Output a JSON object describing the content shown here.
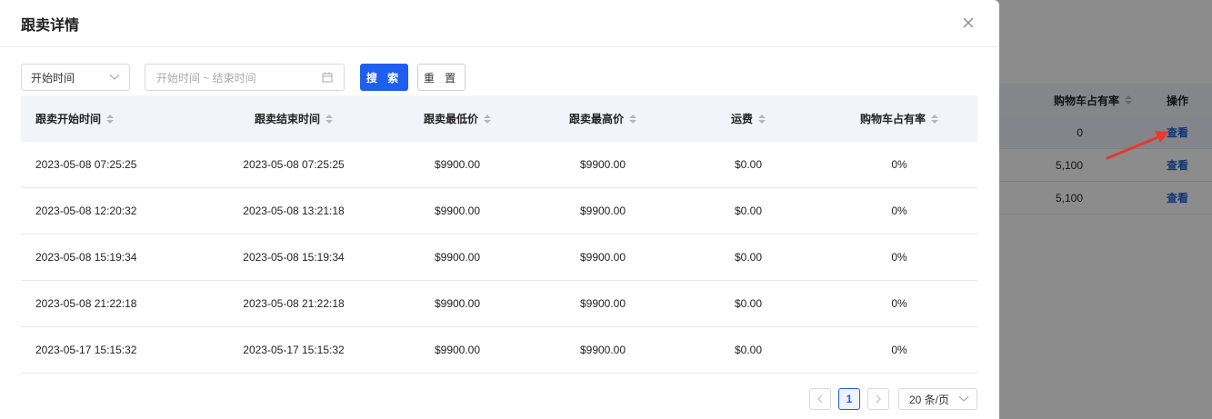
{
  "modal": {
    "title": "跟卖详情"
  },
  "filters": {
    "field_select": "开始时间",
    "range_placeholder": "开始时间 ~ 结束时间",
    "search_label": "搜 索",
    "reset_label": "重 置"
  },
  "table": {
    "columns": [
      "跟卖开始时间",
      "跟卖结束时间",
      "跟卖最低价",
      "跟卖最高价",
      "运费",
      "购物车占有率"
    ],
    "rows": [
      [
        "2023-05-08 07:25:25",
        "2023-05-08 07:25:25",
        "$9900.00",
        "$9900.00",
        "$0.00",
        "0%"
      ],
      [
        "2023-05-08 12:20:32",
        "2023-05-08 13:21:18",
        "$9900.00",
        "$9900.00",
        "$0.00",
        "0%"
      ],
      [
        "2023-05-08 15:19:34",
        "2023-05-08 15:19:34",
        "$9900.00",
        "$9900.00",
        "$0.00",
        "0%"
      ],
      [
        "2023-05-08 21:22:18",
        "2023-05-08 21:22:18",
        "$9900.00",
        "$9900.00",
        "$0.00",
        "0%"
      ],
      [
        "2023-05-17 15:15:32",
        "2023-05-17 15:15:32",
        "$9900.00",
        "$9900.00",
        "$0.00",
        "0%"
      ]
    ]
  },
  "pagination": {
    "current_page": "1",
    "page_size": "20 条/页"
  },
  "background_table": {
    "col_rate": "购物车占有率",
    "col_action": "操作",
    "rows": [
      {
        "rate": "0",
        "action": "查看"
      },
      {
        "rate": "5,100",
        "action": "查看"
      },
      {
        "rate": "5,100",
        "action": "查看"
      }
    ]
  },
  "colors": {
    "primary": "#1f5ff0",
    "annotation_arrow": "#e8392c"
  }
}
